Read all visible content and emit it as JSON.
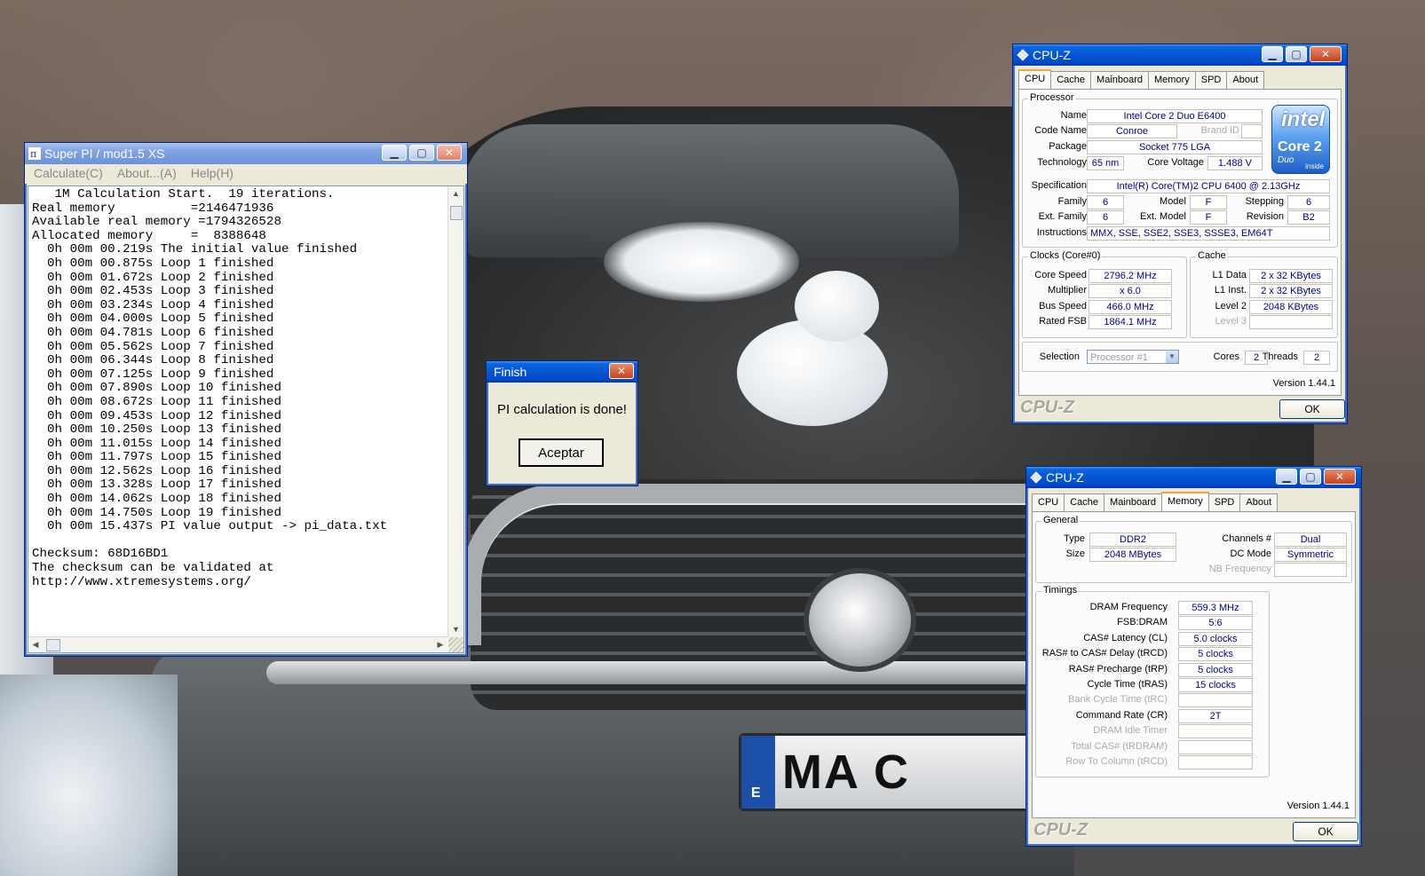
{
  "superpi": {
    "title": "Super PI / mod1.5 XS",
    "menu": [
      "Calculate(C)",
      "About...(A)",
      "Help(H)"
    ],
    "log": [
      "   1M Calculation Start.  19 iterations.",
      "Real memory          =2146471936",
      "Available real memory =1794326528",
      "Allocated memory     =  8388648",
      "  0h 00m 00.219s The initial value finished",
      "  0h 00m 00.875s Loop 1 finished",
      "  0h 00m 01.672s Loop 2 finished",
      "  0h 00m 02.453s Loop 3 finished",
      "  0h 00m 03.234s Loop 4 finished",
      "  0h 00m 04.000s Loop 5 finished",
      "  0h 00m 04.781s Loop 6 finished",
      "  0h 00m 05.562s Loop 7 finished",
      "  0h 00m 06.344s Loop 8 finished",
      "  0h 00m 07.125s Loop 9 finished",
      "  0h 00m 07.890s Loop 10 finished",
      "  0h 00m 08.672s Loop 11 finished",
      "  0h 00m 09.453s Loop 12 finished",
      "  0h 00m 10.250s Loop 13 finished",
      "  0h 00m 11.015s Loop 14 finished",
      "  0h 00m 11.797s Loop 15 finished",
      "  0h 00m 12.562s Loop 16 finished",
      "  0h 00m 13.328s Loop 17 finished",
      "  0h 00m 14.062s Loop 18 finished",
      "  0h 00m 14.750s Loop 19 finished",
      "  0h 00m 15.437s PI value output -> pi_data.txt",
      "",
      "Checksum: 68D16BD1",
      "The checksum can be validated at",
      "http://www.xtremesystems.org/"
    ]
  },
  "finish": {
    "title": "Finish",
    "message": "PI calculation is done!",
    "button": "Aceptar"
  },
  "cpuz_cpu": {
    "title": "CPU-Z",
    "tabs": [
      "CPU",
      "Cache",
      "Mainboard",
      "Memory",
      "SPD",
      "About"
    ],
    "processor_group": "Processor",
    "name_label": "Name",
    "name": "Intel Core 2 Duo E6400",
    "codename_label": "Code Name",
    "codename": "Conroe",
    "brandid_label": "Brand ID",
    "package_label": "Package",
    "package": "Socket 775 LGA",
    "technology_label": "Technology",
    "technology": "65 nm",
    "corevoltage_label": "Core Voltage",
    "corevoltage": "1.488 V",
    "spec_label": "Specification",
    "spec": "Intel(R) Core(TM)2 CPU          6400  @ 2.13GHz",
    "family_label": "Family",
    "family": "6",
    "model_label": "Model",
    "model": "F",
    "stepping_label": "Stepping",
    "stepping": "6",
    "extfamily_label": "Ext. Family",
    "extfamily": "6",
    "extmodel_label": "Ext. Model",
    "extmodel": "F",
    "revision_label": "Revision",
    "revision": "B2",
    "instructions_label": "Instructions",
    "instructions": "MMX, SSE, SSE2, SSE3, SSSE3, EM64T",
    "clocks_group": "Clocks (Core#0)",
    "corespeed_label": "Core Speed",
    "corespeed": "2796.2 MHz",
    "multiplier_label": "Multiplier",
    "multiplier": "x 6.0",
    "busspeed_label": "Bus Speed",
    "busspeed": "466.0 MHz",
    "ratedfsb_label": "Rated FSB",
    "ratedfsb": "1864.1 MHz",
    "cache_group": "Cache",
    "l1data_label": "L1 Data",
    "l1data": "2 x 32 KBytes",
    "l1inst_label": "L1 Inst.",
    "l1inst": "2 x 32 KBytes",
    "level2_label": "Level 2",
    "level2": "2048 KBytes",
    "level3_label": "Level 3",
    "selection_label": "Selection",
    "selection": "Processor #1",
    "cores_label": "Cores",
    "cores": "2",
    "threads_label": "Threads",
    "threads": "2",
    "version": "Version 1.44.1",
    "footer_logo": "CPU-Z",
    "ok": "OK",
    "intel_logo": {
      "brand": "intel",
      "line1": "Core 2",
      "line2": "Duo",
      "line3": "inside"
    }
  },
  "cpuz_mem": {
    "title": "CPU-Z",
    "tabs": [
      "CPU",
      "Cache",
      "Mainboard",
      "Memory",
      "SPD",
      "About"
    ],
    "general_group": "General",
    "type_label": "Type",
    "type": "DDR2",
    "size_label": "Size",
    "size": "2048 MBytes",
    "channels_label": "Channels #",
    "channels": "Dual",
    "dcmode_label": "DC Mode",
    "dcmode": "Symmetric",
    "nbfreq_label": "NB Frequency",
    "timings_group": "Timings",
    "timings": [
      {
        "label": "DRAM Frequency",
        "value": "559.3 MHz",
        "enabled": true
      },
      {
        "label": "FSB:DRAM",
        "value": "5:6",
        "enabled": true
      },
      {
        "label": "CAS# Latency (CL)",
        "value": "5.0 clocks",
        "enabled": true
      },
      {
        "label": "RAS# to CAS# Delay (tRCD)",
        "value": "5 clocks",
        "enabled": true
      },
      {
        "label": "RAS# Precharge (tRP)",
        "value": "5 clocks",
        "enabled": true
      },
      {
        "label": "Cycle Time (tRAS)",
        "value": "15 clocks",
        "enabled": true
      },
      {
        "label": "Bank Cycle Time (tRC)",
        "value": "",
        "enabled": false
      },
      {
        "label": "Command Rate (CR)",
        "value": "2T",
        "enabled": true
      },
      {
        "label": "DRAM Idle Timer",
        "value": "",
        "enabled": false
      },
      {
        "label": "Total CAS# (tRDRAM)",
        "value": "",
        "enabled": false
      },
      {
        "label": "Row To Column (tRCD)",
        "value": "",
        "enabled": false
      }
    ],
    "version": "Version 1.44.1",
    "footer_logo": "CPU-Z",
    "ok": "OK"
  },
  "plate": {
    "eu": "E",
    "text": "MA  C"
  },
  "colors": {
    "xp_title_blue": "#0655d3",
    "cpuz_value": "#00008b",
    "window_face": "#ece9d8"
  }
}
